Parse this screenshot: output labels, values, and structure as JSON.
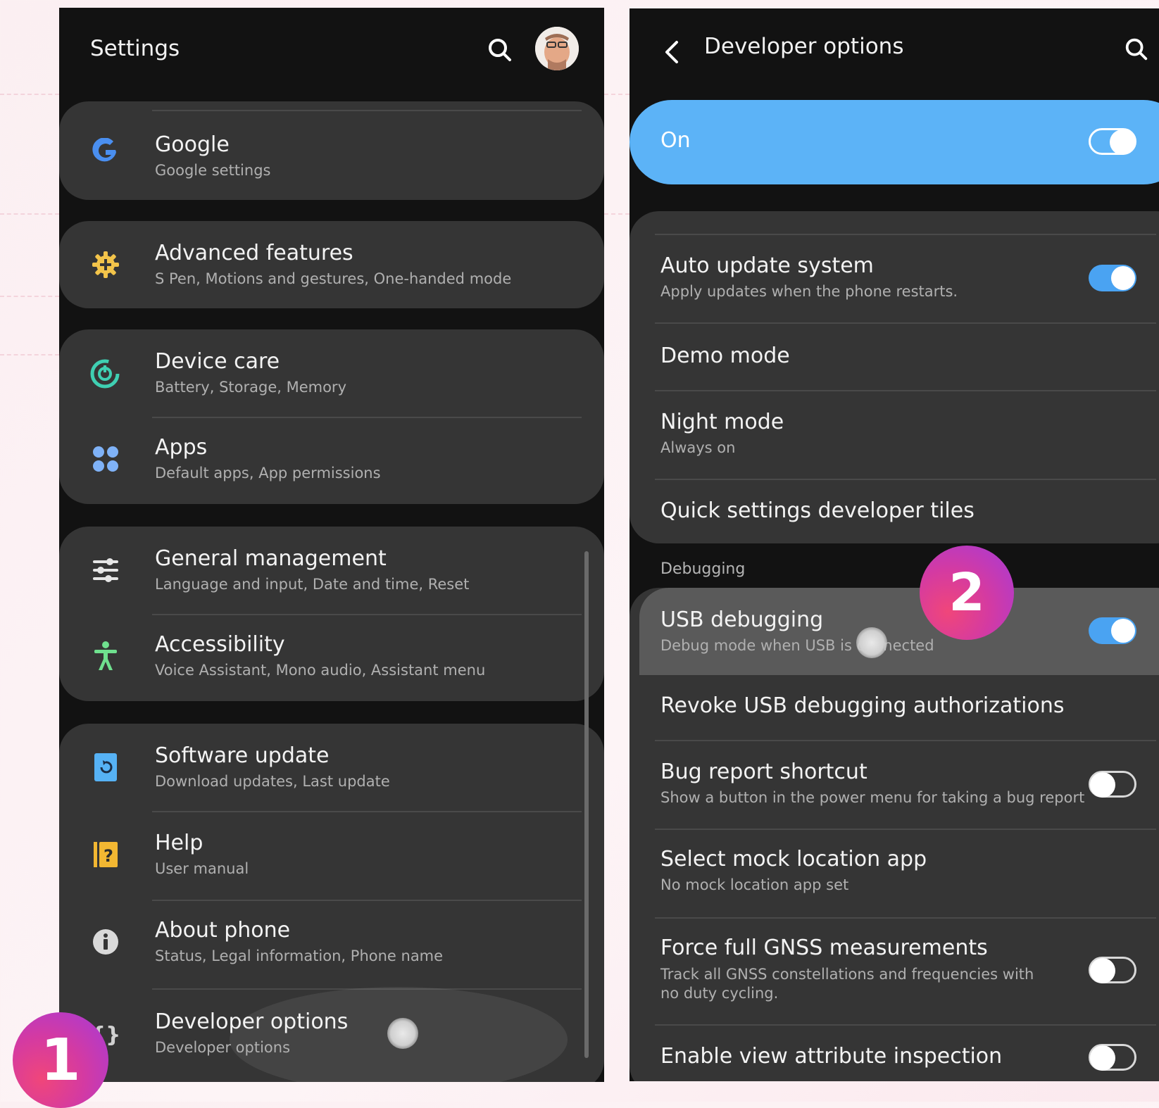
{
  "settings": {
    "title": "Settings",
    "items": [
      {
        "title": "Google",
        "subtitle": "Google settings",
        "icon": "google-icon"
      },
      {
        "title": "Advanced features",
        "subtitle": "S Pen, Motions and gestures, One-handed mode",
        "icon": "gear-plus-icon"
      },
      {
        "title": "Device care",
        "subtitle": "Battery, Storage, Memory",
        "icon": "device-care-icon"
      },
      {
        "title": "Apps",
        "subtitle": "Default apps, App permissions",
        "icon": "apps-icon"
      },
      {
        "title": "General management",
        "subtitle": "Language and input, Date and time, Reset",
        "icon": "sliders-icon"
      },
      {
        "title": "Accessibility",
        "subtitle": "Voice Assistant, Mono audio, Assistant menu",
        "icon": "accessibility-icon"
      },
      {
        "title": "Software update",
        "subtitle": "Download updates, Last update",
        "icon": "software-update-icon"
      },
      {
        "title": "Help",
        "subtitle": "User manual",
        "icon": "help-icon"
      },
      {
        "title": "About phone",
        "subtitle": "Status, Legal information, Phone name",
        "icon": "info-icon"
      },
      {
        "title": "Developer options",
        "subtitle": "Developer options",
        "icon": "braces-icon"
      }
    ]
  },
  "developer": {
    "title": "Developer options",
    "master_label": "On",
    "master_on": true,
    "items": [
      {
        "title": "Auto update system",
        "subtitle": "Apply updates when the phone restarts.",
        "toggle": true
      },
      {
        "title": "Demo mode"
      },
      {
        "title": "Night mode",
        "subtitle": "Always on"
      },
      {
        "title": "Quick settings developer tiles"
      }
    ],
    "section_debugging": "Debugging",
    "debug_items": [
      {
        "title": "USB debugging",
        "subtitle": "Debug mode when USB is connected",
        "toggle": true
      },
      {
        "title": "Revoke USB debugging authorizations"
      },
      {
        "title": "Bug report shortcut",
        "subtitle": "Show a button in the power menu for taking a bug report",
        "toggle": false
      },
      {
        "title": "Select mock location app",
        "subtitle": "No mock location app set"
      },
      {
        "title": "Force full GNSS measurements",
        "subtitle": "Track all GNSS constellations and frequencies with no duty cycling.",
        "toggle": false
      },
      {
        "title": "Enable view attribute inspection",
        "toggle": false
      }
    ]
  },
  "badges": {
    "step1": "1",
    "step2": "2"
  },
  "colors": {
    "accent_blue": "#5cb3f7",
    "toggle_on": "#4aa3f2",
    "card_bg": "#353535",
    "badge_pink": "#f0467a",
    "badge_purple": "#a53bd9"
  }
}
